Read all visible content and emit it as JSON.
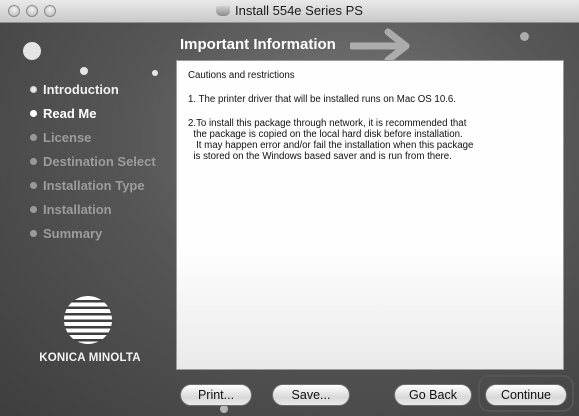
{
  "window": {
    "title": "Install 554e Series PS",
    "title_icon": "disk-drive-icon"
  },
  "sidebar": {
    "steps": [
      {
        "label": "Introduction",
        "state": "completed"
      },
      {
        "label": "Read Me",
        "state": "current"
      },
      {
        "label": "License",
        "state": "upcoming"
      },
      {
        "label": "Destination Select",
        "state": "upcoming"
      },
      {
        "label": "Installation Type",
        "state": "upcoming"
      },
      {
        "label": "Installation",
        "state": "upcoming"
      },
      {
        "label": "Summary",
        "state": "upcoming"
      }
    ],
    "logo_text": "KONICA MINOLTA"
  },
  "main": {
    "heading": "Important Information",
    "paragraphs": [
      "Cautions and restrictions",
      "1. The printer driver that will be installed runs on Mac OS 10.6.",
      "2.To install this package through network, it is recommended that\n  the package is copied on the local hard disk before installation.\n   It may happen error and/or fail the installation when this package\n  is stored on the Windows based saver and is run from there."
    ]
  },
  "buttons": {
    "print": "Print...",
    "save": "Save...",
    "go_back": "Go Back",
    "continue": "Continue"
  }
}
